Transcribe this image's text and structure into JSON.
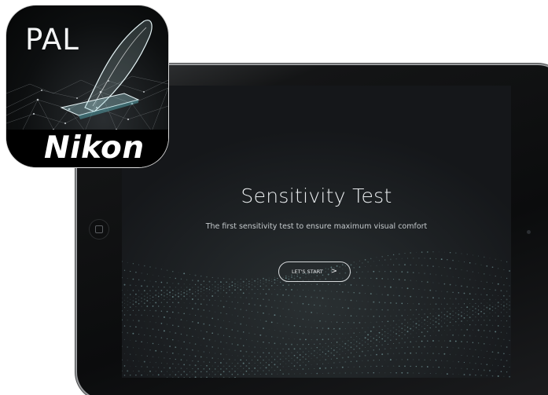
{
  "screen": {
    "title": "Sensitivity Test",
    "subtitle": "The first sensitivity test to ensure maximum visual comfort",
    "start_button_label": "LET'S START",
    "start_button_icon": "chevron-right-icon",
    "start_button_glyph": ">"
  },
  "app_icon": {
    "label": "PAL",
    "brand": "Nikon"
  },
  "colors": {
    "screen_background": "#17191b",
    "particles": "#7fa6a8",
    "text": "#e9ecee",
    "brand_band": "#000000"
  }
}
